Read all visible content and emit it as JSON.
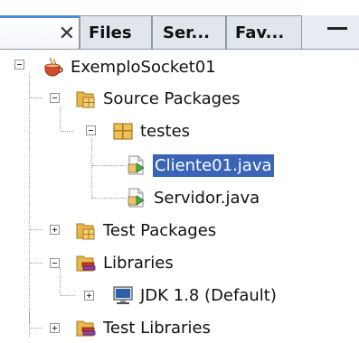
{
  "tabs": {
    "close_glyph": "✕",
    "files": "Files",
    "services": "Ser...",
    "favorites": "Fav..."
  },
  "tree": {
    "project": "ExemploSocket01",
    "source_packages": "Source Packages",
    "package": "testes",
    "file1": "Cliente01.java",
    "file2": "Servidor.java",
    "test_packages": "Test Packages",
    "libraries": "Libraries",
    "jdk": "JDK 1.8 (Default)",
    "test_libraries": "Test Libraries"
  },
  "colors": {
    "selection": "#3a64b5",
    "folder": "#e8b74a",
    "active_tab_accent": "#4b88d8"
  },
  "icons": [
    "close-icon",
    "minimize-icon",
    "coffee-cup-project-icon",
    "package-folder-icon",
    "package-icon",
    "java-file-icon",
    "library-folder-icon",
    "jdk-computer-icon"
  ]
}
